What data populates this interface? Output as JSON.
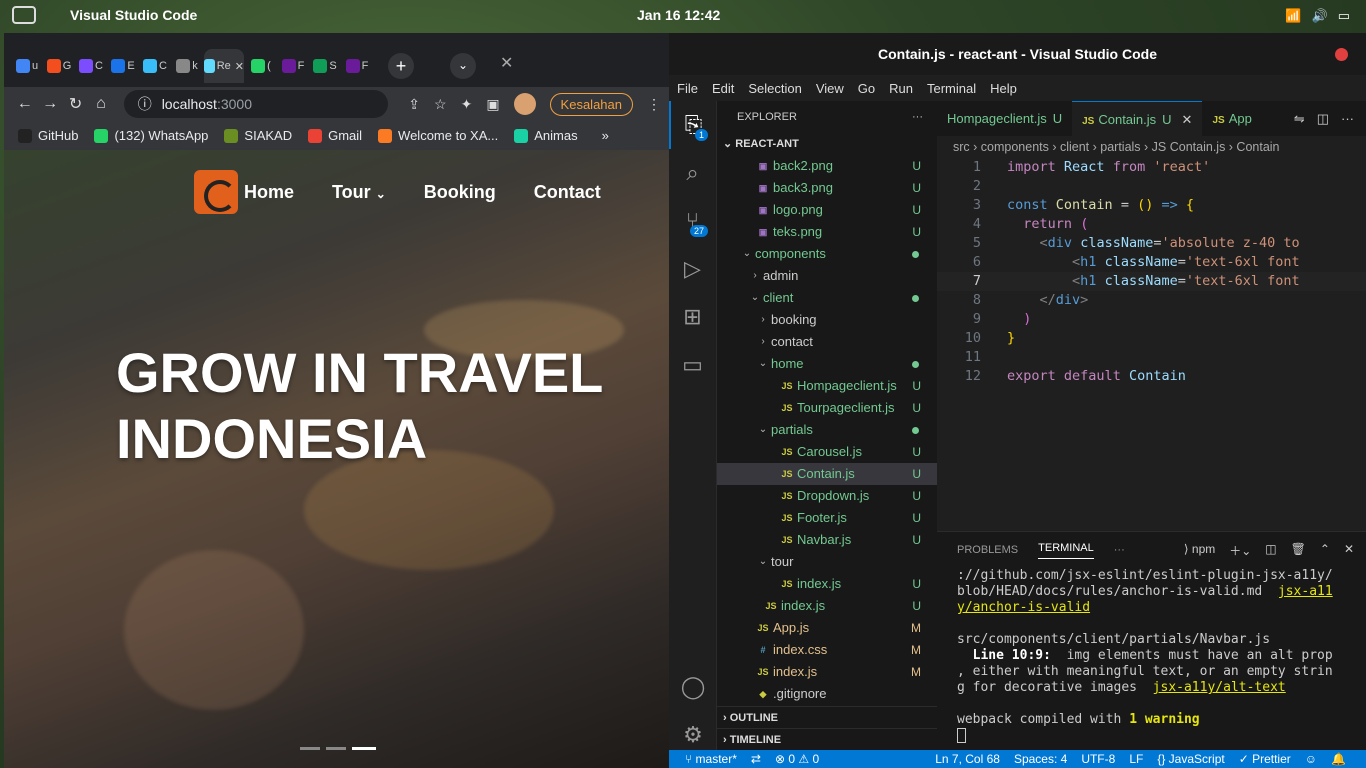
{
  "topbar": {
    "app_title": "Visual Studio Code",
    "clock": "Jan 16  12:42"
  },
  "chrome": {
    "tabs": [
      {
        "label": "u",
        "color": "#4285f4"
      },
      {
        "label": "G",
        "color": "#f24e1e"
      },
      {
        "label": "C",
        "color": "#7c4dff"
      },
      {
        "label": "E",
        "color": "#1a73e8"
      },
      {
        "label": "C",
        "color": "#38bdf8"
      },
      {
        "label": "k",
        "color": "#888888"
      },
      {
        "label": "Re",
        "color": "#61dafb"
      },
      {
        "label": "(",
        "color": "#25d366"
      },
      {
        "label": "F",
        "color": "#6a1b9a"
      },
      {
        "label": "S",
        "color": "#0f9d58"
      },
      {
        "label": "F",
        "color": "#6a1b9a"
      }
    ],
    "url_host": "localhost",
    "url_port": ":3000",
    "profile_label": "Kesalahan",
    "bookmarks": [
      {
        "label": "GitHub",
        "color": "#222222"
      },
      {
        "label": "(132) WhatsApp",
        "color": "#25d366"
      },
      {
        "label": "SIAKAD",
        "color": "#6b8e23"
      },
      {
        "label": "Gmail",
        "color": "#ea4335"
      },
      {
        "label": "Welcome to XA...",
        "color": "#fb7a24"
      },
      {
        "label": "Animas",
        "color": "#1ad1a5"
      }
    ],
    "more": "»"
  },
  "site": {
    "nav": {
      "home": "Home",
      "tour": "Tour",
      "booking": "Booking",
      "contact": "Contact"
    },
    "hero_line1": "GROW IN TRAVEL",
    "hero_line2": "INDONESIA"
  },
  "vscode": {
    "title": "Contain.js - react-ant - Visual Studio Code",
    "menu": [
      "File",
      "Edit",
      "Selection",
      "View",
      "Go",
      "Run",
      "Terminal",
      "Help"
    ],
    "activity_badges": {
      "explorer": "1",
      "scm": "27"
    },
    "explorer_title": "EXPLORER",
    "explorer_more": "···",
    "root": "REACT-ANT",
    "tree": [
      {
        "label": "back2.png",
        "indent": 1,
        "type": "img",
        "status": "U"
      },
      {
        "label": "back3.png",
        "indent": 1,
        "type": "img",
        "status": "U"
      },
      {
        "label": "logo.png",
        "indent": 1,
        "type": "img",
        "status": "U"
      },
      {
        "label": "teks.png",
        "indent": 1,
        "type": "img",
        "status": "U"
      },
      {
        "label": "components",
        "indent": 1,
        "type": "folder-open",
        "status": "dot"
      },
      {
        "label": "admin",
        "indent": 2,
        "type": "folder",
        "status": ""
      },
      {
        "label": "client",
        "indent": 2,
        "type": "folder-open",
        "status": "dot"
      },
      {
        "label": "booking",
        "indent": 3,
        "type": "folder",
        "status": ""
      },
      {
        "label": "contact",
        "indent": 3,
        "type": "folder",
        "status": ""
      },
      {
        "label": "home",
        "indent": 3,
        "type": "folder-open",
        "status": "dot"
      },
      {
        "label": "Hompageclient.js",
        "indent": 4,
        "type": "js",
        "status": "U"
      },
      {
        "label": "Tourpageclient.js",
        "indent": 4,
        "type": "js",
        "status": "U"
      },
      {
        "label": "partials",
        "indent": 3,
        "type": "folder-open",
        "status": "dot"
      },
      {
        "label": "Carousel.js",
        "indent": 4,
        "type": "js",
        "status": "U"
      },
      {
        "label": "Contain.js",
        "indent": 4,
        "type": "js",
        "status": "U",
        "selected": true
      },
      {
        "label": "Dropdown.js",
        "indent": 4,
        "type": "js",
        "status": "U"
      },
      {
        "label": "Footer.js",
        "indent": 4,
        "type": "js",
        "status": "U"
      },
      {
        "label": "Navbar.js",
        "indent": 4,
        "type": "js",
        "status": "U"
      },
      {
        "label": "tour",
        "indent": 3,
        "type": "folder-open",
        "status": ""
      },
      {
        "label": "index.js",
        "indent": 4,
        "type": "js",
        "status": "U",
        "nochild": true
      },
      {
        "label": "index.js",
        "indent": 2,
        "type": "js",
        "status": "U"
      },
      {
        "label": "App.js",
        "indent": 1,
        "type": "js",
        "status": "M"
      },
      {
        "label": "index.css",
        "indent": 1,
        "type": "css",
        "status": "M"
      },
      {
        "label": "index.js",
        "indent": 1,
        "type": "js",
        "status": "M"
      },
      {
        "label": ".gitignore",
        "indent": 1,
        "type": "git",
        "status": ""
      }
    ],
    "outline": "OUTLINE",
    "timeline": "TIMELINE",
    "editor_tabs": [
      {
        "label": "Hompageclient.js",
        "status": "U"
      },
      {
        "label": "Contain.js",
        "status": "U",
        "active": true
      },
      {
        "label": "App",
        "status": ""
      }
    ],
    "breadcrumb": "src  ›  components  ›  client  ›  partials  ›  JS Contain.js  ›  Contain",
    "panel_tabs": {
      "problems": "PROBLEMS",
      "terminal": "TERMINAL",
      "shell": "npm"
    },
    "terminal": {
      "l1": "://github.com/jsx-eslint/eslint-plugin-jsx-a11y/",
      "l2a": "blob/HEAD/docs/rules/anchor-is-valid.md  ",
      "l2b": "jsx-a11",
      "l3": "y/anchor-is-valid",
      "l5": "src/components/client/partials/Navbar.js",
      "l6a": "  Line 10:9:",
      "l6b": "  img elements must have an alt prop",
      "l7": ", either with meaningful text, or an empty strin",
      "l8a": "g for decorative images  ",
      "l8b": "jsx-a11y/alt-text",
      "l10a": "webpack compiled with ",
      "l10b": "1 warning"
    },
    "status": {
      "branch": "master*",
      "errors": "⊗ 0 ⚠ 0",
      "pos": "Ln 7, Col 68",
      "spaces": "Spaces: 4",
      "enc": "UTF-8",
      "eol": "LF",
      "lang": "{} JavaScript",
      "prettier": "✓ Prettier"
    }
  }
}
